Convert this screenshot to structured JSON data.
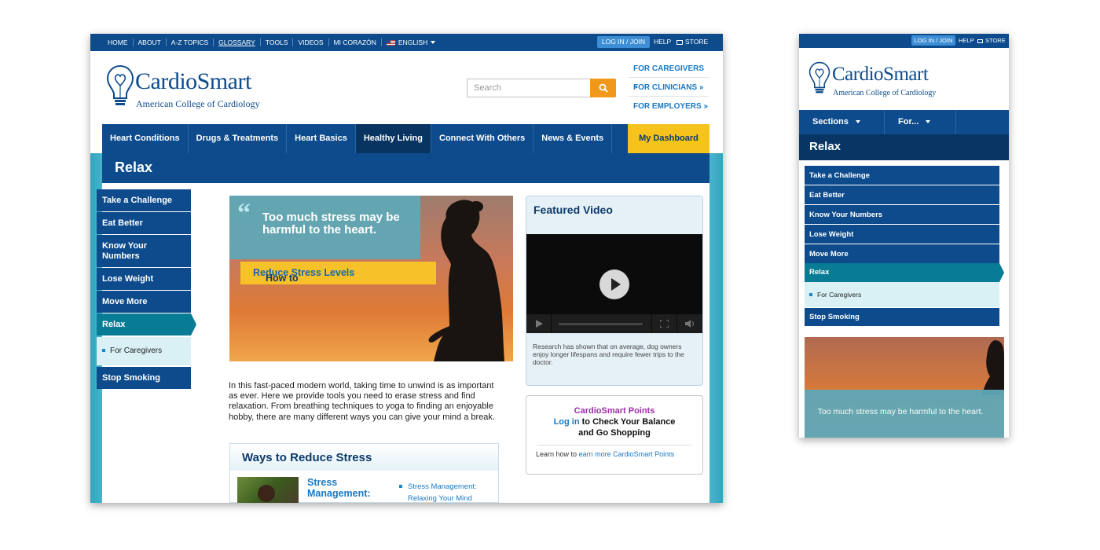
{
  "desktop": {
    "topnav": {
      "links": [
        "HOME",
        "ABOUT",
        "A-Z TOPICS",
        "GLOSSARY",
        "TOOLS",
        "VIDEOS",
        "MI CORAZÓN"
      ],
      "language": "ENGLISH",
      "login": "LOG IN / JOIN",
      "help": "HELP",
      "store": "STORE"
    },
    "logo": {
      "name": "CardioSmart",
      "tagline": "American College of Cardiology"
    },
    "search": {
      "placeholder": "Search"
    },
    "for_links": [
      "FOR CAREGIVERS »",
      "FOR CLINICIANS »",
      "FOR EMPLOYERS »"
    ],
    "main_nav": [
      "Heart Conditions",
      "Drugs & Treatments",
      "Heart Basics",
      "Healthy Living",
      "Connect With Others",
      "News & Events"
    ],
    "main_nav_active": "Healthy Living",
    "dashboard": "My Dashboard",
    "page_title": "Relax",
    "sidebar": [
      "Take a Challenge",
      "Eat Better",
      "Know Your Numbers",
      "Lose Weight",
      "Move More",
      "Relax",
      "For Caregivers",
      "Stop Smoking"
    ],
    "sidebar_active": "Relax",
    "hero": {
      "quote": "Too much stress may be harmful to the heart.",
      "cta_prefix": "How to",
      "cta_link": "Reduce Stress Levels"
    },
    "body_text": "In this fast-paced modern world, taking time to unwind is as important as ever. Here we provide tools you need to erase stress and find relaxation. From breathing techniques to yoga to finding an enjoyable hobby, there are many different ways you can give your mind a break.",
    "ways": {
      "title": "Ways to Reduce Stress",
      "item_title": "Stress Management:",
      "item_link": "Stress Management: Relaxing Your Mind"
    },
    "video": {
      "title": "Featured Video",
      "caption": "Research has shown that on average, dog owners enjoy longer lifespans and require fewer trips to the doctor."
    },
    "points": {
      "title": "CardioSmart Points",
      "login": "Log in",
      "line1": "to Check Your Balance",
      "line2": "and Go Shopping",
      "learn_prefix": "Learn how to",
      "learn_link": "earn more CardioSmart Points"
    }
  },
  "mobile": {
    "topbar": {
      "login": "LOG IN / JOIN",
      "help": "HELP",
      "store": "STORE"
    },
    "logo": {
      "name": "CardioSmart",
      "tagline": "American College of Cardiology"
    },
    "nav": [
      "Sections",
      "For..."
    ],
    "page_title": "Relax",
    "sidebar": [
      "Take a Challenge",
      "Eat Better",
      "Know Your Numbers",
      "Lose Weight",
      "Move More",
      "Relax",
      "For Caregivers",
      "Stop Smoking"
    ],
    "hero_caption": "Too much stress may be harmful to the heart."
  },
  "colors": {
    "brand_navy": "#0d4b8c",
    "dark_navy": "#083563",
    "teal_active": "#087b95",
    "accent_yellow": "#f5c31b",
    "search_orange": "#f09819",
    "link_blue": "#1a79c3",
    "points_purple": "#9b2fa8"
  },
  "icons": [
    "lightbulb-heart-logo-icon",
    "us-flag-icon",
    "cart-icon",
    "search-icon",
    "play-icon",
    "fullscreen-icon",
    "volume-icon",
    "chevron-down-icon",
    "quote-icon"
  ]
}
